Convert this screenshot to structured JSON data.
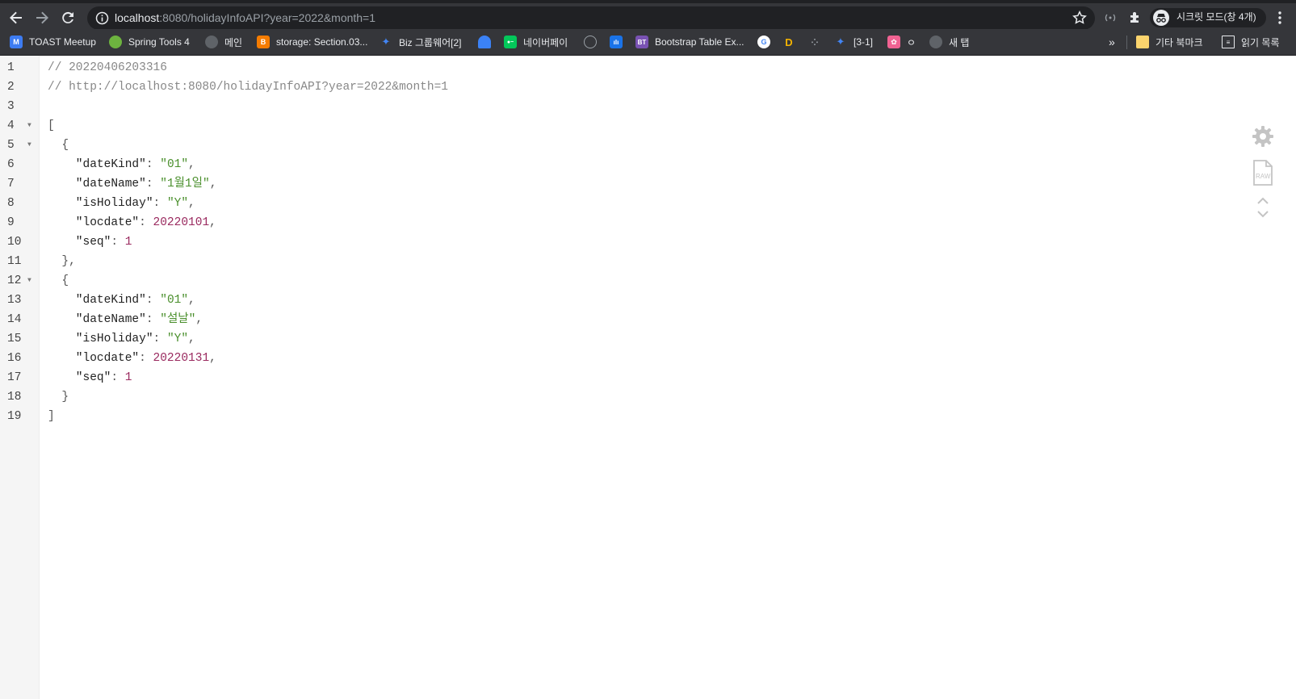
{
  "browser": {
    "url_host": "localhost",
    "url_rest": ":8080/holidayInfoAPI?year=2022&month=1",
    "profile_label": "시크릿 모드(창 4개)"
  },
  "bookmarks": [
    {
      "label": "TOAST Meetup",
      "badge": "M",
      "color": "#3d7cf2"
    },
    {
      "label": "Spring Tools 4",
      "badge": "",
      "color": "#6db33f"
    },
    {
      "label": "메인",
      "badge": "",
      "color": "#5f6368"
    },
    {
      "label": "storage: Section.03...",
      "badge": "B",
      "color": "#f57c00"
    },
    {
      "label": "Biz 그룹웨어[2]",
      "badge": "",
      "color": "#4285f4"
    },
    {
      "label": "",
      "badge": "",
      "color": "#3b82f6"
    },
    {
      "label": "네이버페이",
      "badge": "",
      "color": "#03c75a"
    },
    {
      "label": "",
      "badge": "",
      "color": "#9aa0a6"
    },
    {
      "label": "",
      "badge": "",
      "color": "#1a73e8"
    },
    {
      "label": "Bootstrap Table Ex...",
      "badge": "BT",
      "color": "#7952b3"
    },
    {
      "label": "",
      "badge": "G",
      "color": "#ffffff"
    },
    {
      "label": "",
      "badge": "D",
      "color": "#f4b400"
    },
    {
      "label": "",
      "badge": "",
      "color": "#9aa0a6"
    },
    {
      "label": "[3-1]",
      "badge": "",
      "color": "#4285f4"
    },
    {
      "label": "ㅇ",
      "badge": "",
      "color": "#f06292"
    },
    {
      "label": "새 탭",
      "badge": "",
      "color": "#5f6368"
    }
  ],
  "bookmarks_overflow": "»",
  "other_bookmarks": "기타 북마크",
  "reading_list": "읽기 목록",
  "viewer": {
    "comment_timestamp": "// 20220406203316",
    "comment_url": "// http://localhost:8080/holidayInfoAPI?year=2022&month=1",
    "raw_label": "RAW",
    "entries": [
      {
        "dateKind": "01",
        "dateName": "1월1일",
        "isHoliday": "Y",
        "locdate": 20220101,
        "seq": 1
      },
      {
        "dateKind": "01",
        "dateName": "설날",
        "isHoliday": "Y",
        "locdate": 20220131,
        "seq": 1
      }
    ]
  },
  "colors": {
    "chrome_toolbar": "#35363a",
    "omnibox": "#202124",
    "json_string": "#4a8f2c",
    "json_number": "#9a2a5f"
  }
}
